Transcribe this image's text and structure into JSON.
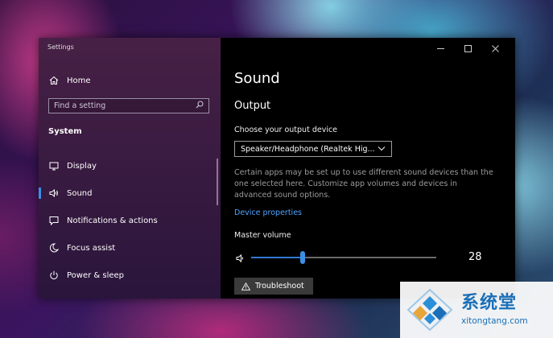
{
  "window": {
    "app_title": "Settings",
    "controls": [
      "minimize",
      "maximize",
      "close"
    ]
  },
  "sidebar": {
    "home_label": "Home",
    "search_placeholder": "Find a setting",
    "section_label": "System",
    "items": [
      {
        "label": "Display",
        "icon": "monitor-icon"
      },
      {
        "label": "Sound",
        "icon": "speaker-icon",
        "selected": true
      },
      {
        "label": "Notifications & actions",
        "icon": "notification-icon"
      },
      {
        "label": "Focus assist",
        "icon": "moon-icon"
      },
      {
        "label": "Power & sleep",
        "icon": "power-icon"
      }
    ]
  },
  "main": {
    "page_title": "Sound",
    "output": {
      "section_title": "Output",
      "device_label": "Choose your output device",
      "device_value": "Speaker/Headphone (Realtek Hig...",
      "description": "Certain apps may be set up to use different sound devices than the one selected here. Customize app volumes and devices in advanced sound options.",
      "link_label": "Device properties",
      "volume_label": "Master volume",
      "volume_value": 28,
      "volume_text": "28",
      "troubleshoot_label": "Troubleshoot"
    }
  },
  "watermark": {
    "brand_cn": "系统堂",
    "brand_en": "xitongtang.com"
  },
  "colors": {
    "accent": "#3d8ee6",
    "link": "#4ea3ff",
    "watermark": "#1a6fb8"
  }
}
